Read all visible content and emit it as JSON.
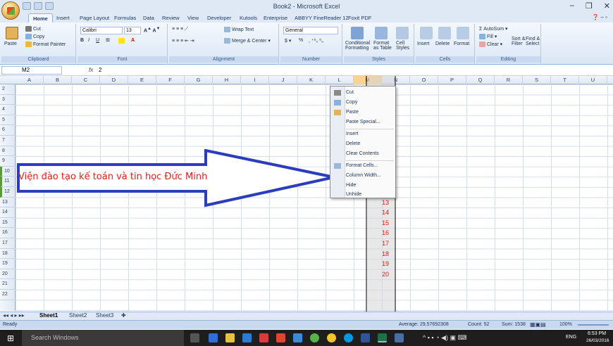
{
  "window": {
    "title": "Book2 - Microsoft Excel"
  },
  "tabs": [
    "Home",
    "Insert",
    "Page Layout",
    "Formulas",
    "Data",
    "Review",
    "View",
    "Developer",
    "Kutools",
    "Enterprise",
    "ABBYY FineReader 12",
    "Foxit PDF"
  ],
  "ribbon": {
    "clipboard": {
      "label": "Clipboard",
      "paste": "Paste",
      "cut": "Cut",
      "copy": "Copy",
      "format_painter": "Format Painter"
    },
    "font": {
      "label": "Font",
      "name": "Calibri",
      "size": "13",
      "bold": "B",
      "italic": "I",
      "underline": "U"
    },
    "alignment": {
      "label": "Alignment",
      "wrap": "Wrap Text",
      "merge": "Merge & Center"
    },
    "number": {
      "label": "Number",
      "format": "General",
      "currency": "$",
      "percent": "%"
    },
    "styles": {
      "label": "Styles",
      "conditional": "Conditional Formatting",
      "format_table": "Format as Table",
      "cell_styles": "Cell Styles"
    },
    "cells": {
      "label": "Cells",
      "insert": "Insert",
      "delete": "Delete",
      "format": "Format"
    },
    "editing": {
      "label": "Editing",
      "autosum": "AutoSum",
      "fill": "Fill",
      "clear": "Clear",
      "sort": "Sort & Filter",
      "find": "Find & Select"
    }
  },
  "formula_bar": {
    "name_box": "M2",
    "fx": "fx",
    "value": "2"
  },
  "columns": [
    "A",
    "B",
    "C",
    "D",
    "E",
    "F",
    "G",
    "H",
    "I",
    "J",
    "K",
    "L",
    "M",
    "N",
    "O",
    "P",
    "Q",
    "R",
    "S",
    "T",
    "U"
  ],
  "selected_column": "M",
  "rows": [
    "2",
    "3",
    "4",
    "5",
    "6",
    "7",
    "8",
    "9",
    "10",
    "11",
    "12",
    "13",
    "14",
    "15",
    "16",
    "17",
    "18",
    "19",
    "20",
    "21",
    "22"
  ],
  "m_values": [
    "12",
    "13",
    "14",
    "15",
    "16",
    "17",
    "18",
    "19",
    "20"
  ],
  "annotation": "Viện đào tạo kế toán và tin học Đức Minh",
  "context_menu": [
    "Cut",
    "Copy",
    "Paste",
    "Paste Special...",
    "Insert",
    "Delete",
    "Clear Contents",
    "Format Cells...",
    "Column Width...",
    "Hide",
    "Unhide"
  ],
  "sheets": [
    "Sheet1",
    "Sheet2",
    "Sheet3"
  ],
  "status": {
    "ready": "Ready",
    "average": "Average: 29,57692308",
    "count": "Count: 52",
    "sum": "Sum: 1538",
    "zoom": "100%"
  },
  "taskbar": {
    "search": "Search Windows",
    "lang": "ENG",
    "time": "6:53 PM",
    "date": "26/03/2016"
  },
  "colors": {
    "accent": "#dfe9f5",
    "annotation": "#e51c1c",
    "arrow": "#2b3dbd"
  }
}
